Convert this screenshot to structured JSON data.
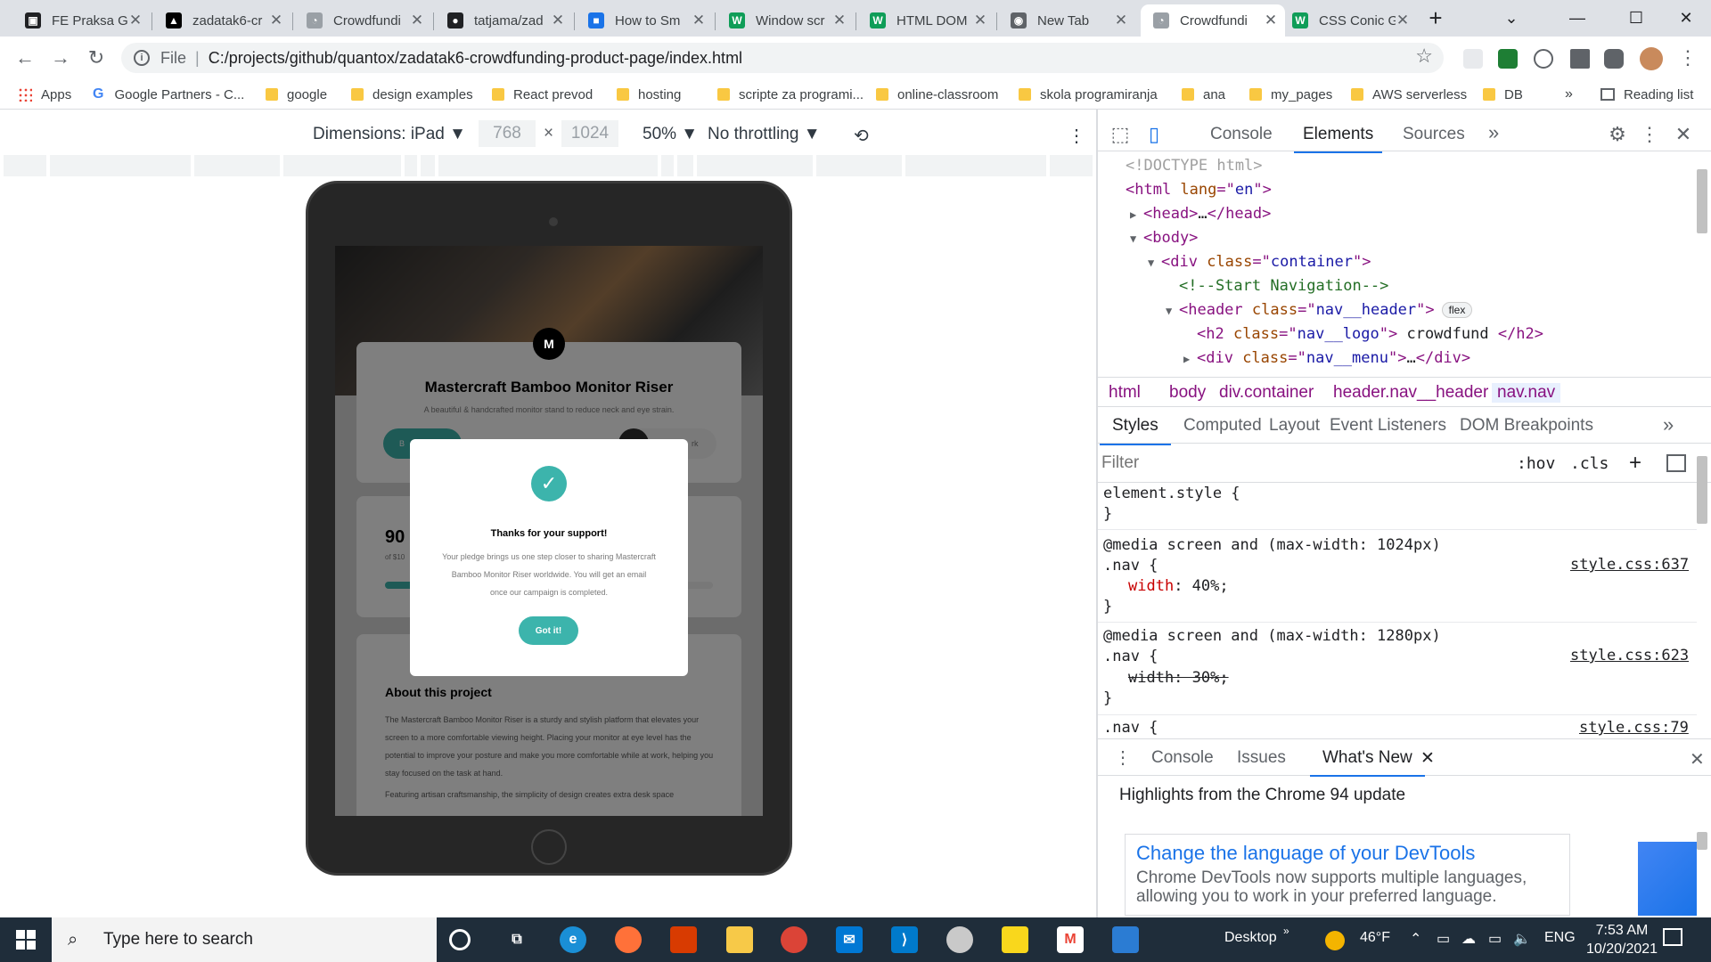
{
  "browser": {
    "tabs": [
      {
        "title": "FE Praksa G",
        "color": "#202124",
        "glyph": "▣"
      },
      {
        "title": "zadatak6-cr",
        "color": "#000000",
        "glyph": "▲"
      },
      {
        "title": "Crowdfundi",
        "color": "#9aa0a6",
        "glyph": "◔"
      },
      {
        "title": "tatjama/zad",
        "color": "#202124",
        "glyph": "●"
      },
      {
        "title": "How to Sm",
        "color": "#1a73e8",
        "glyph": "■"
      },
      {
        "title": "Window scr",
        "color": "#0f9d58",
        "glyph": "W"
      },
      {
        "title": "HTML DOM",
        "color": "#0f9d58",
        "glyph": "W"
      },
      {
        "title": "New Tab",
        "color": "#5f6368",
        "glyph": "◉"
      },
      {
        "title": "Crowdfundi",
        "color": "#9aa0a6",
        "glyph": "◔"
      },
      {
        "title": "CSS Conic G",
        "color": "#0f9d58",
        "glyph": "W"
      }
    ],
    "new_tab_icon": "+",
    "address": {
      "scheme": "File",
      "url": "C:/projects/github/quantox/zadatak6-crowdfunding-product-page/index.html"
    },
    "bookmarks": [
      {
        "label": "Apps",
        "icon": "apps-grid-icon"
      },
      {
        "label": "Google Partners - C...",
        "icon": "google-icon"
      },
      {
        "label": "google",
        "icon": "folder-icon"
      },
      {
        "label": "design examples",
        "icon": "folder-icon"
      },
      {
        "label": "React prevod",
        "icon": "folder-icon"
      },
      {
        "label": "hosting",
        "icon": "folder-icon"
      },
      {
        "label": "scripte za programi...",
        "icon": "folder-icon"
      },
      {
        "label": "online-classroom",
        "icon": "folder-icon"
      },
      {
        "label": "skola programiranja",
        "icon": "folder-icon"
      },
      {
        "label": "ana",
        "icon": "folder-icon"
      },
      {
        "label": "my_pages",
        "icon": "folder-icon"
      },
      {
        "label": "AWS serverless",
        "icon": "folder-icon"
      },
      {
        "label": "DB",
        "icon": "folder-icon"
      }
    ],
    "bookmarks_overflow": "»",
    "reading_list": "Reading list"
  },
  "device_toolbar": {
    "dimensions_label": "Dimensions: iPad ▼",
    "width": "768",
    "times": "×",
    "height": "1024",
    "zoom": "50% ▼",
    "throttling": "No throttling ▼"
  },
  "page": {
    "logo": "M",
    "product_title": "Mastercraft Bamboo Monitor Riser",
    "product_subtitle": "A beautiful & handcrafted monitor stand to reduce neck and eye strain.",
    "button_partial_left": "B",
    "button_partial_right": "rk",
    "stat_value": "90",
    "stat_caption": "of $10",
    "about_heading": "About this project",
    "about_p1": "The Mastercraft Bamboo Monitor Riser is a sturdy and stylish platform that elevates your screen to a more comfortable viewing height. Placing your monitor at eye level has the potential to improve your posture and make you more comfortable while at work, helping you stay focused on the task at hand.",
    "about_p2": "Featuring artisan craftsmanship, the simplicity of design creates extra desk space",
    "accent": "#3cb4ac",
    "modal": {
      "title": "Thanks for your support!",
      "text": "Your pledge brings us one step closer to sharing Mastercraft Bamboo Monitor Riser worldwide. You will get an email once our campaign is completed.",
      "button": "Got it!"
    }
  },
  "devtools": {
    "tabs": [
      "Console",
      "Elements",
      "Sources"
    ],
    "active_tab": "Elements",
    "more": "»",
    "dom": [
      {
        "indent": 0,
        "arrow": "",
        "parts": [
          [
            "gray",
            "<!DOCTYPE html>"
          ]
        ]
      },
      {
        "indent": 0,
        "arrow": "",
        "parts": [
          [
            "tagc",
            "<html "
          ],
          [
            "attr",
            "lang"
          ],
          [
            "tagc",
            "=\""
          ],
          [
            "val",
            "en"
          ],
          [
            "tagc",
            "\">"
          ]
        ]
      },
      {
        "indent": 1,
        "arrow": "▶",
        "parts": [
          [
            "tagc",
            "<head>"
          ],
          [
            "txt",
            "…"
          ],
          [
            "tagc",
            "</head>"
          ]
        ]
      },
      {
        "indent": 1,
        "arrow": "▼",
        "parts": [
          [
            "tagc",
            "<body>"
          ]
        ]
      },
      {
        "indent": 2,
        "arrow": "▼",
        "parts": [
          [
            "tagc",
            "<div "
          ],
          [
            "attr",
            "class"
          ],
          [
            "tagc",
            "=\""
          ],
          [
            "val",
            "container"
          ],
          [
            "tagc",
            "\">"
          ]
        ]
      },
      {
        "indent": 3,
        "arrow": "",
        "parts": [
          [
            "cmt",
            "<!--Start Navigation-->"
          ]
        ]
      },
      {
        "indent": 3,
        "arrow": "▼",
        "parts": [
          [
            "tagc",
            "<header "
          ],
          [
            "attr",
            "class"
          ],
          [
            "tagc",
            "=\""
          ],
          [
            "val",
            "nav__header"
          ],
          [
            "tagc",
            "\">"
          ]
        ],
        "badge": "flex"
      },
      {
        "indent": 4,
        "arrow": "",
        "parts": [
          [
            "tagc",
            "<h2 "
          ],
          [
            "attr",
            "class"
          ],
          [
            "tagc",
            "=\""
          ],
          [
            "val",
            "nav__logo"
          ],
          [
            "tagc",
            "\">"
          ],
          [
            "txt",
            " crowdfund "
          ],
          [
            "tagc",
            "</h2>"
          ]
        ]
      },
      {
        "indent": 4,
        "arrow": "▶",
        "parts": [
          [
            "tagc",
            "<div "
          ],
          [
            "attr",
            "class"
          ],
          [
            "tagc",
            "=\""
          ],
          [
            "val",
            "nav__menu"
          ],
          [
            "tagc",
            "\">"
          ],
          [
            "txt",
            "…"
          ],
          [
            "tagc",
            "</div>"
          ]
        ]
      }
    ],
    "breadcrumbs": [
      "html",
      "body",
      "div.container",
      "header.nav__header",
      "nav.nav"
    ],
    "style_tabs": [
      "Styles",
      "Computed",
      "Layout",
      "Event Listeners",
      "DOM Breakpoints"
    ],
    "style_tabs_more": "»",
    "filter_placeholder": "Filter",
    "hov": ":hov",
    "cls": ".cls",
    "styles": {
      "element_style": "element.style {",
      "close": "}",
      "rule1_media": "@media screen and (max-width: 1024px)",
      "rule1_selector": ".nav {",
      "rule1_prop": "width",
      "rule1_value": " 40%;",
      "rule1_source": "style.css:637",
      "rule2_media": "@media screen and (max-width: 1280px)",
      "rule2_selector": ".nav {",
      "rule2_decl": "width: 30%;",
      "rule2_source": "style.css:623",
      "rule3_selector": ".nav {",
      "rule3_source": "style.css:79"
    },
    "drawer_tabs": [
      "Console",
      "Issues",
      "What's New"
    ],
    "highlights": "Highlights from the Chrome 94 update",
    "whats_new_title": "Change the language of your DevTools",
    "whats_new_desc": "Chrome DevTools now supports multiple languages, allowing you to work in your preferred language."
  },
  "taskbar": {
    "search_placeholder": "Type here to search",
    "desktop": "Desktop",
    "weather": "46°F",
    "lang": "ENG",
    "time": "7:53 AM",
    "date": "10/20/2021"
  }
}
